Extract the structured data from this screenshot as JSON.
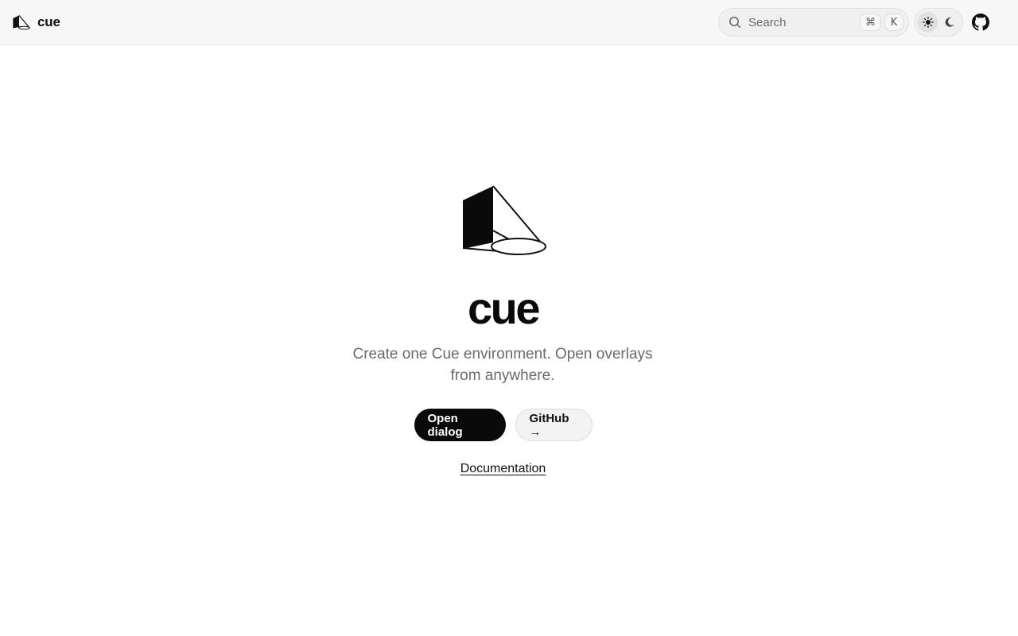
{
  "header": {
    "brand_name": "cue",
    "search": {
      "placeholder": "Search",
      "shortcut_keys": [
        "⌘",
        "K"
      ]
    },
    "theme_toggle": {
      "options": [
        "light-theme",
        "dark-theme"
      ],
      "active": "light-theme"
    },
    "github_icon": "github-icon"
  },
  "hero": {
    "title": "cue",
    "subtitle": "Create one Cue environment. Open overlays from anywhere.",
    "primary_button": "Open dialog",
    "secondary_button": "GitHub →",
    "doc_link": "Documentation"
  },
  "colors": {
    "header_bg": "#f7f7f7",
    "primary_button_bg": "#0a0a0a",
    "text_muted": "#6a6a6a"
  }
}
